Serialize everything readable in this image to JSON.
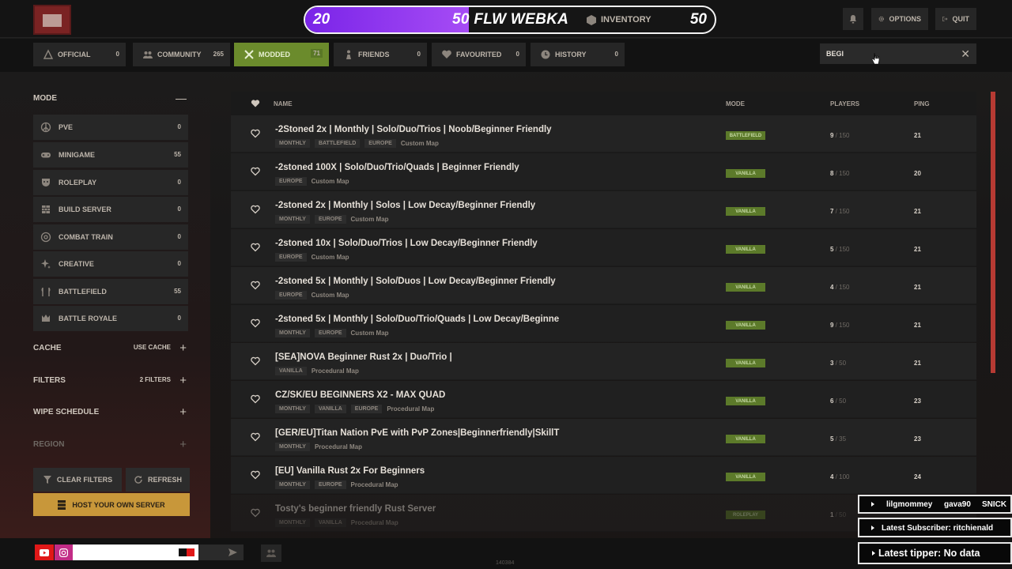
{
  "goal_bar": {
    "left_number": "20",
    "label": "50 FLW WEBKA",
    "right_number": "50",
    "progress": 0.4
  },
  "header": {
    "inventory": "INVENTORY",
    "options": "OPTIONS",
    "quit": "QUIT",
    "icons": [
      "bell-icon",
      "gear-icon",
      "exit-icon"
    ]
  },
  "tabs": [
    {
      "label": "OFFICIAL",
      "count": "0",
      "icon": "rust-icon"
    },
    {
      "label": "COMMUNITY",
      "count": "265",
      "icon": "group-icon"
    },
    {
      "label": "MODDED",
      "count": "71",
      "icon": "tools-icon",
      "active": true
    },
    {
      "label": "FRIENDS",
      "count": "0",
      "icon": "person-icon"
    },
    {
      "label": "FAVOURITED",
      "count": "0",
      "icon": "heart-icon"
    },
    {
      "label": "HISTORY",
      "count": "0",
      "icon": "clock-icon"
    }
  ],
  "search": {
    "value": "BEGI"
  },
  "sidebar": {
    "mode_title": "MODE",
    "modes": [
      {
        "label": "PVE",
        "count": "0",
        "icon": "peace-icon"
      },
      {
        "label": "MINIGAME",
        "count": "55",
        "icon": "gamepad-icon"
      },
      {
        "label": "ROLEPLAY",
        "count": "0",
        "icon": "mask-icon"
      },
      {
        "label": "BUILD SERVER",
        "count": "0",
        "icon": "brick-icon"
      },
      {
        "label": "COMBAT TRAIN",
        "count": "0",
        "icon": "target-icon"
      },
      {
        "label": "CREATIVE",
        "count": "0",
        "icon": "sparkle-icon"
      },
      {
        "label": "BATTLEFIELD",
        "count": "55",
        "icon": "axes-icon"
      },
      {
        "label": "BATTLE ROYALE",
        "count": "0",
        "icon": "crown-icon"
      }
    ],
    "cache": {
      "title": "CACHE",
      "value": "USE CACHE"
    },
    "filters": {
      "title": "FILTERS",
      "value": "2 FILTERS"
    },
    "wipe": {
      "title": "WIPE SCHEDULE"
    },
    "region": {
      "title": "REGION"
    },
    "clear": "CLEAR FILTERS",
    "refresh": "REFRESH",
    "host": "HOST YOUR OWN SERVER"
  },
  "list": {
    "columns": {
      "name": "NAME",
      "mode": "MODE",
      "players": "PLAYERS",
      "ping": "PING"
    },
    "rows": [
      {
        "name": "-2Stoned 2x | Monthly | Solo/Duo/Trios | Noob/Beginner Friendly",
        "tags": [
          "MONTHLY",
          "BATTLEFIELD",
          "EUROPE"
        ],
        "map": "Custom Map",
        "mode": "BATTLEFIELD",
        "players": "9",
        "max": "150",
        "ping": "21"
      },
      {
        "name": "-2stoned 100X | Solo/Duo/Trio/Quads | Beginner Friendly",
        "tags": [
          "EUROPE"
        ],
        "map": "Custom Map",
        "mode": "VANILLA",
        "players": "8",
        "max": "150",
        "ping": "20"
      },
      {
        "name": "-2stoned 2x | Monthly | Solos | Low Decay/Beginner Friendly",
        "tags": [
          "MONTHLY",
          "EUROPE"
        ],
        "map": "Custom Map",
        "mode": "VANILLA",
        "players": "7",
        "max": "150",
        "ping": "21"
      },
      {
        "name": "-2stoned 10x | Solo/Duo/Trios | Low Decay/Beginner Friendly",
        "tags": [
          "EUROPE"
        ],
        "map": "Custom Map",
        "mode": "VANILLA",
        "players": "5",
        "max": "150",
        "ping": "21"
      },
      {
        "name": "-2stoned 5x | Monthly | Solo/Duos | Low Decay/Beginner Friendly",
        "tags": [
          "EUROPE"
        ],
        "map": "Custom Map",
        "mode": "VANILLA",
        "players": "4",
        "max": "150",
        "ping": "21"
      },
      {
        "name": "-2stoned 5x | Monthly | Solo/Duo/Trio/Quads | Low Decay/Beginne",
        "tags": [
          "MONTHLY",
          "EUROPE"
        ],
        "map": "Custom Map",
        "mode": "VANILLA",
        "players": "9",
        "max": "150",
        "ping": "21"
      },
      {
        "name": "[SEA]NOVA Beginner Rust 2x | Duo/Trio |",
        "tags": [
          "VANILLA"
        ],
        "map": "Procedural Map",
        "mode": "VANILLA",
        "players": "3",
        "max": "50",
        "ping": "21"
      },
      {
        "name": "CZ/SK/EU BEGINNERS X2 - MAX QUAD",
        "tags": [
          "MONTHLY",
          "VANILLA",
          "EUROPE"
        ],
        "map": "Procedural Map",
        "mode": "VANILLA",
        "players": "6",
        "max": "50",
        "ping": "23"
      },
      {
        "name": "[GER/EU]Titan Nation PvE with PvP Zones|Beginnerfriendly|SkillT",
        "tags": [
          "MONTHLY"
        ],
        "map": "Procedural Map",
        "mode": "VANILLA",
        "players": "5",
        "max": "35",
        "ping": "23"
      },
      {
        "name": "[EU] Vanilla Rust 2x For Beginners",
        "tags": [
          "MONTHLY",
          "EUROPE"
        ],
        "map": "Procedural Map",
        "mode": "VANILLA",
        "players": "4",
        "max": "100",
        "ping": "24"
      },
      {
        "name": "Tosty's beginner friendly Rust Server",
        "tags": [
          "MONTHLY",
          "VANILLA"
        ],
        "map": "Procedural Map",
        "mode": "ROLEPLAY",
        "players": "1",
        "max": "50",
        "ping": ""
      }
    ]
  },
  "version": "140384",
  "overlay": {
    "names": [
      "lilgmommey",
      "gava90",
      "SNICK"
    ],
    "subscriber": "Latest Subscriber: ritchienald",
    "tipper": "Latest tipper: No data"
  }
}
